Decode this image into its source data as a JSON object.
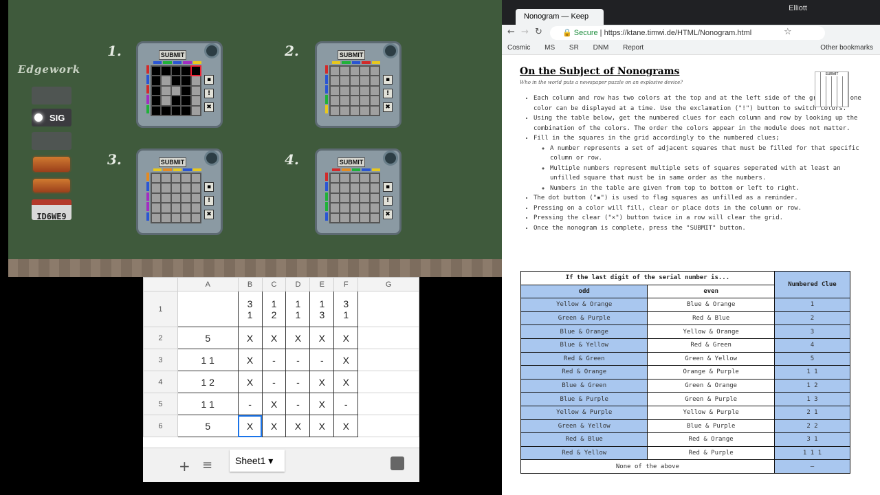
{
  "game": {
    "module_numbers": [
      "1.",
      "2.",
      "3.",
      "4."
    ],
    "edgework_label": "Edgework",
    "indicator_label": "SIG",
    "serial_label": "SERIAL #",
    "serial_number": "ID6WE9",
    "submit_label": "SUBMIT",
    "side_buttons": [
      "",
      "!",
      "✖"
    ],
    "m1_filled": [
      1,
      1,
      1,
      1,
      1,
      1,
      0,
      1,
      1,
      0,
      1,
      0,
      0,
      1,
      0,
      1,
      0,
      1,
      1,
      0,
      1,
      1,
      1,
      1,
      0
    ],
    "top_colors": [
      [
        "#2a55d4",
        "#1fb238",
        "#2a55d4",
        "#a22dc2",
        "#e8c81d"
      ],
      [
        "#e8c81d",
        "#1fb238",
        "#2a55d4",
        "#d22a2a",
        "#e8c81d"
      ],
      [
        "#e8c81d",
        "#e58a20",
        "#e8c81d",
        "#2a55d4",
        "#e8c81d"
      ],
      [
        "#d22a2a",
        "#e58a20",
        "#1fb238",
        "#2a55d4",
        "#e8c81d"
      ]
    ],
    "left_colors": [
      [
        "#d22a2a",
        "#2a55d4",
        "#d22a2a",
        "#a22dc2",
        "#1fb238"
      ],
      [
        "#d22a2a",
        "#2a55d4",
        "#2a55d4",
        "#1fb238",
        "#e8c81d"
      ],
      [
        "#e58a20",
        "#2a55d4",
        "#a22dc2",
        "#a22dc2",
        "#2a55d4"
      ],
      [
        "#d22a2a",
        "#2a55d4",
        "#1fb238",
        "#1fb238",
        "#2a55d4"
      ]
    ]
  },
  "sheet": {
    "cols": [
      "",
      "A",
      "B",
      "C",
      "D",
      "E",
      "F",
      "G"
    ],
    "rows": [
      [
        "1",
        "",
        "3\n1",
        "1\n2",
        "1\n1",
        "1\n3",
        "3\n1",
        ""
      ],
      [
        "2",
        "5",
        "X",
        "X",
        "X",
        "X",
        "X",
        ""
      ],
      [
        "3",
        "1 1",
        "X",
        "-",
        "-",
        "-",
        "X",
        ""
      ],
      [
        "4",
        "1 2",
        "X",
        "-",
        "-",
        "X",
        "X",
        ""
      ],
      [
        "5",
        "1 1",
        "-",
        "X",
        "-",
        "X",
        "-",
        ""
      ],
      [
        "6",
        "5",
        "X",
        "X",
        "X",
        "X",
        "X",
        ""
      ]
    ],
    "tab_label": "Sheet1"
  },
  "browser": {
    "tab_title": "Nonogram — Keep Talki",
    "user": "Elliott",
    "secure": "Secure",
    "url": "https://ktane.timwi.de/HTML/Nonogram.html",
    "bookmarks": [
      "Cosmic",
      "MS",
      "SR",
      "DNM",
      "Report",
      "Other bookmarks"
    ]
  },
  "doc": {
    "title": "On the Subject of Nonograms",
    "subtitle": "Who in the world puts a newspaper puzzle on an explosive device?",
    "bullets": [
      "Each column and row has two colors at the top and at the left side of the grid; only one color can be displayed at a time. Use the exclamation (\"!\") button to switch colors.",
      "Using the table below, get the numbered clues for each column and row by looking up the combination of the colors. The order the colors appear in the module does not matter.",
      "Fill in the squares in the grid accordingly to the numbered clues;"
    ],
    "sub_bullets": [
      "A number represents a set of adjacent squares that must be filled for that specific column or row.",
      "Multiple numbers represent multiple sets of squares seperated with at least an unfilled square that must be in same order as the numbers.",
      "Numbers in the table are given from top to bottom or left to right."
    ],
    "bullets2": [
      "The dot button (\"▪\") is used to flag squares as unfilled as a reminder.",
      "Pressing on a color will fill, clear or place dots in the column or row.",
      "Pressing the clear (\"×\") button twice in a row will clear the grid.",
      "Once the nonogram is complete, press the \"SUBMIT\" button."
    ]
  },
  "clues": {
    "header": "If the last digit of the serial number is...",
    "odd": "odd",
    "even": "even",
    "clue_header": "Numbered Clue",
    "rows": [
      [
        "Yellow & Orange",
        "Blue & Orange",
        "1"
      ],
      [
        "Green & Purple",
        "Red & Blue",
        "2"
      ],
      [
        "Blue & Orange",
        "Yellow & Orange",
        "3"
      ],
      [
        "Blue & Yellow",
        "Red & Green",
        "4"
      ],
      [
        "Red & Green",
        "Green & Yellow",
        "5"
      ],
      [
        "Red & Orange",
        "Orange & Purple",
        "1 1"
      ],
      [
        "Blue & Green",
        "Green & Orange",
        "1 2"
      ],
      [
        "Blue & Purple",
        "Green & Purple",
        "1 3"
      ],
      [
        "Yellow & Purple",
        "Yellow & Purple",
        "2 1"
      ],
      [
        "Green & Yellow",
        "Blue & Purple",
        "2 2"
      ],
      [
        "Red & Blue",
        "Red & Orange",
        "3 1"
      ],
      [
        "Red & Yellow",
        "Red & Purple",
        "1 1 1"
      ]
    ],
    "none_label": "None of the above",
    "none_clue": "—"
  }
}
